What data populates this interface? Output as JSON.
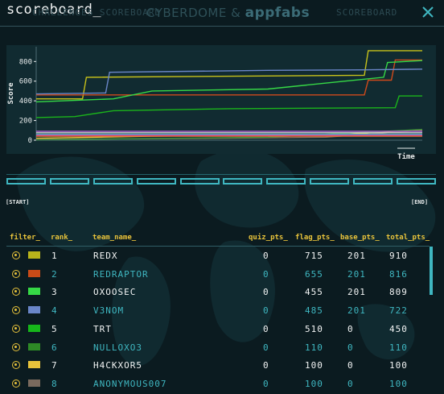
{
  "window": {
    "title": "scoreboard_",
    "bg_nav_left": "CHALLENGES SCOREBOARD",
    "bg_logo_part1": "CYBERDOME",
    "bg_logo_amp": "&",
    "bg_logo_part2": "appfabs",
    "bg_nav_right": "SCOREBOARD",
    "close_icon": "close-icon"
  },
  "chart_data": {
    "type": "line",
    "ylabel": "Score",
    "xlabel": "Time",
    "yticks": [
      0,
      200,
      400,
      600,
      800
    ],
    "ylim": [
      0,
      950
    ],
    "xlim": [
      0,
      1
    ],
    "grid": false,
    "series": [
      {
        "color": "#c8c21a",
        "points": [
          [
            0,
            420
          ],
          [
            0.12,
            420
          ],
          [
            0.13,
            640
          ],
          [
            0.85,
            660
          ],
          [
            0.86,
            910
          ],
          [
            1,
            910
          ]
        ]
      },
      {
        "color": "#d04a1b",
        "points": [
          [
            0,
            460
          ],
          [
            0.85,
            460
          ],
          [
            0.86,
            610
          ],
          [
            0.92,
            610
          ],
          [
            0.93,
            816
          ],
          [
            1,
            816
          ]
        ]
      },
      {
        "color": "#36d946",
        "points": [
          [
            0,
            390
          ],
          [
            0.2,
            420
          ],
          [
            0.3,
            500
          ],
          [
            0.6,
            520
          ],
          [
            0.8,
            600
          ],
          [
            0.9,
            640
          ],
          [
            0.91,
            790
          ],
          [
            1,
            809
          ]
        ]
      },
      {
        "color": "#6a86c8",
        "points": [
          [
            0,
            470
          ],
          [
            0.18,
            480
          ],
          [
            0.19,
            690
          ],
          [
            0.6,
            710
          ],
          [
            0.85,
            715
          ],
          [
            1,
            722
          ]
        ]
      },
      {
        "color": "#1bb51b",
        "points": [
          [
            0,
            230
          ],
          [
            0.1,
            240
          ],
          [
            0.2,
            300
          ],
          [
            0.5,
            320
          ],
          [
            0.93,
            330
          ],
          [
            0.94,
            450
          ],
          [
            1,
            450
          ]
        ]
      },
      {
        "color": "#e8c33b",
        "points": [
          [
            0,
            20
          ],
          [
            0.3,
            40
          ],
          [
            0.8,
            60
          ],
          [
            1,
            100
          ]
        ]
      },
      {
        "color": "#8a6f5b",
        "points": [
          [
            0,
            10
          ],
          [
            0.5,
            20
          ],
          [
            0.75,
            30
          ],
          [
            1,
            100
          ]
        ]
      },
      {
        "color": "#3a8f3a",
        "points": [
          [
            0,
            5
          ],
          [
            0.6,
            30
          ],
          [
            1,
            110
          ]
        ]
      },
      {
        "color": "#b06ad0",
        "points": [
          [
            0,
            90
          ],
          [
            1,
            90
          ]
        ]
      },
      {
        "color": "#d0d0d0",
        "points": [
          [
            0,
            75
          ],
          [
            1,
            75
          ]
        ]
      },
      {
        "color": "#3fb7c1",
        "points": [
          [
            0,
            60
          ],
          [
            1,
            60
          ]
        ]
      },
      {
        "color": "#d83ab0",
        "points": [
          [
            0,
            50
          ],
          [
            1,
            50
          ]
        ]
      },
      {
        "color": "#e07030",
        "points": [
          [
            0,
            40
          ],
          [
            1,
            40
          ]
        ]
      }
    ]
  },
  "timeline": {
    "segments": 10,
    "start_label": "[START]",
    "end_label": "[END]"
  },
  "table": {
    "headers": {
      "filter": "filter_",
      "rank": "rank_",
      "team_name": "team_name_",
      "quiz_pts": "quiz_pts_",
      "flag_pts": "flag_pts_",
      "base_pts": "base_pts_",
      "total_pts": "total_pts_"
    },
    "rows": [
      {
        "color": "#b9b41b",
        "rank": "1",
        "team": "REDX",
        "quiz": "0",
        "flag": "715",
        "base": "201",
        "total": "910"
      },
      {
        "color": "#c94b18",
        "rank": "2",
        "team": "REDRAPTOR",
        "quiz": "0",
        "flag": "655",
        "base": "201",
        "total": "816"
      },
      {
        "color": "#36d946",
        "rank": "3",
        "team": "OXOOSEC",
        "quiz": "0",
        "flag": "455",
        "base": "201",
        "total": "809"
      },
      {
        "color": "#6a86c8",
        "rank": "4",
        "team": "V3NOM",
        "quiz": "0",
        "flag": "485",
        "base": "201",
        "total": "722"
      },
      {
        "color": "#16b61a",
        "rank": "5",
        "team": "TRT",
        "quiz": "0",
        "flag": "510",
        "base": "0",
        "total": "450"
      },
      {
        "color": "#2e8a26",
        "rank": "6",
        "team": "NULLOXO3",
        "quiz": "0",
        "flag": "110",
        "base": "0",
        "total": "110"
      },
      {
        "color": "#e8c33b",
        "rank": "7",
        "team": "H4CKXOR5",
        "quiz": "0",
        "flag": "100",
        "base": "0",
        "total": "100"
      },
      {
        "color": "#7a6a5e",
        "rank": "8",
        "team": "ANONYMOUS007",
        "quiz": "0",
        "flag": "100",
        "base": "0",
        "total": "100"
      }
    ]
  }
}
